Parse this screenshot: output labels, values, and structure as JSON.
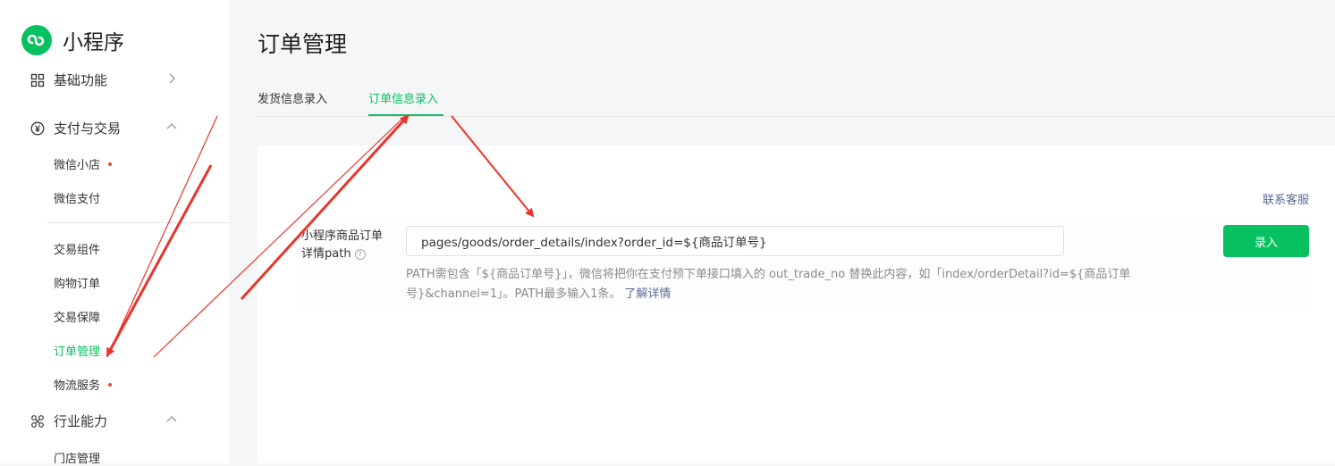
{
  "sidebar": {
    "logo_text": "小程序",
    "groups": {
      "basic": {
        "label": "基础功能",
        "icon": "grid-icon",
        "expanded": false
      },
      "pay": {
        "label": "支付与交易",
        "icon": "yuan-icon",
        "expanded": true
      },
      "industry": {
        "label": "行业能力",
        "icon": "cluster-icon",
        "expanded": true
      }
    },
    "items": [
      {
        "label": "微信小店",
        "badge": true
      },
      {
        "label": "微信支付",
        "badge": false
      },
      {
        "label": "交易组件",
        "badge": false
      },
      {
        "label": "购物订单",
        "badge": false
      },
      {
        "label": "交易保障",
        "badge": false
      },
      {
        "label": "订单管理",
        "badge": false,
        "active": true
      },
      {
        "label": "物流服务",
        "badge": true
      },
      {
        "label": "门店管理",
        "badge": false
      }
    ]
  },
  "main": {
    "title": "订单管理",
    "tabs": [
      {
        "label": "发货信息录入",
        "active": false
      },
      {
        "label": "订单信息录入",
        "active": true
      }
    ],
    "contact_link": "联系客服",
    "form": {
      "label_line1": "小程序商品订单",
      "label_line2": "详情path",
      "path_value": "pages/goods/order_details/index?order_id=${商品订单号}",
      "submit_label": "录入",
      "hint_line1": "PATH需包含「${商品订单号}」，微信将把你在支付预下单接口填入的 out_trade_no 替换此内容，如「index/orderDetail?id=${商品订单",
      "hint_line2": "号}&channel=1」。PATH最多输入1条。",
      "learn_more": "了解详情"
    }
  },
  "colors": {
    "accent": "#07c160",
    "link": "#576b95",
    "badge": "#e04b3c",
    "annotation_arrow": "#e8352b"
  }
}
